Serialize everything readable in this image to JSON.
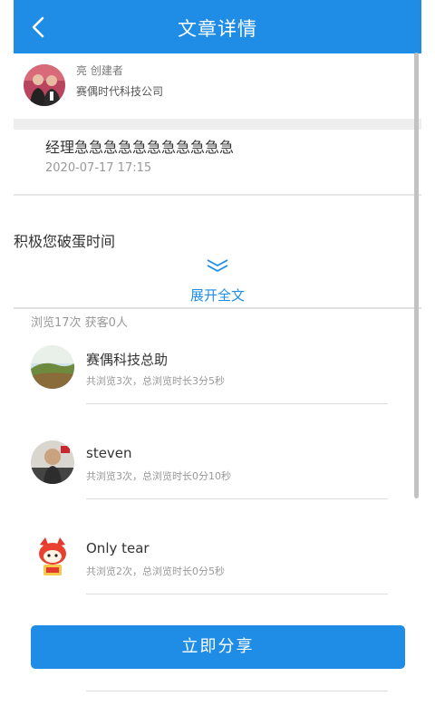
{
  "header": {
    "title": "文章详情",
    "back_icon": "chevron-left-icon"
  },
  "author": {
    "name": "亮 创建者",
    "company": "赛偶时代科技公司"
  },
  "article": {
    "title": "经理急急急急急急急急急急急",
    "date": "2020-07-17 17:15",
    "body": "积极您破蛋时间",
    "expand_label": "展开全文"
  },
  "stats": {
    "text": "浏览17次 获客0人"
  },
  "visitors": [
    {
      "name": "赛偶科技总助",
      "detail": "共浏览3次，总浏览时长3分5秒"
    },
    {
      "name": "steven",
      "detail": "共浏览3次，总浏览时长0分10秒"
    },
    {
      "name": "Only tear",
      "detail": "共浏览2次，总浏览时长0分5秒"
    }
  ],
  "share_button": {
    "label": "立即分享"
  },
  "colors": {
    "accent": "#1f8de6",
    "divider": "#eeeeee"
  }
}
